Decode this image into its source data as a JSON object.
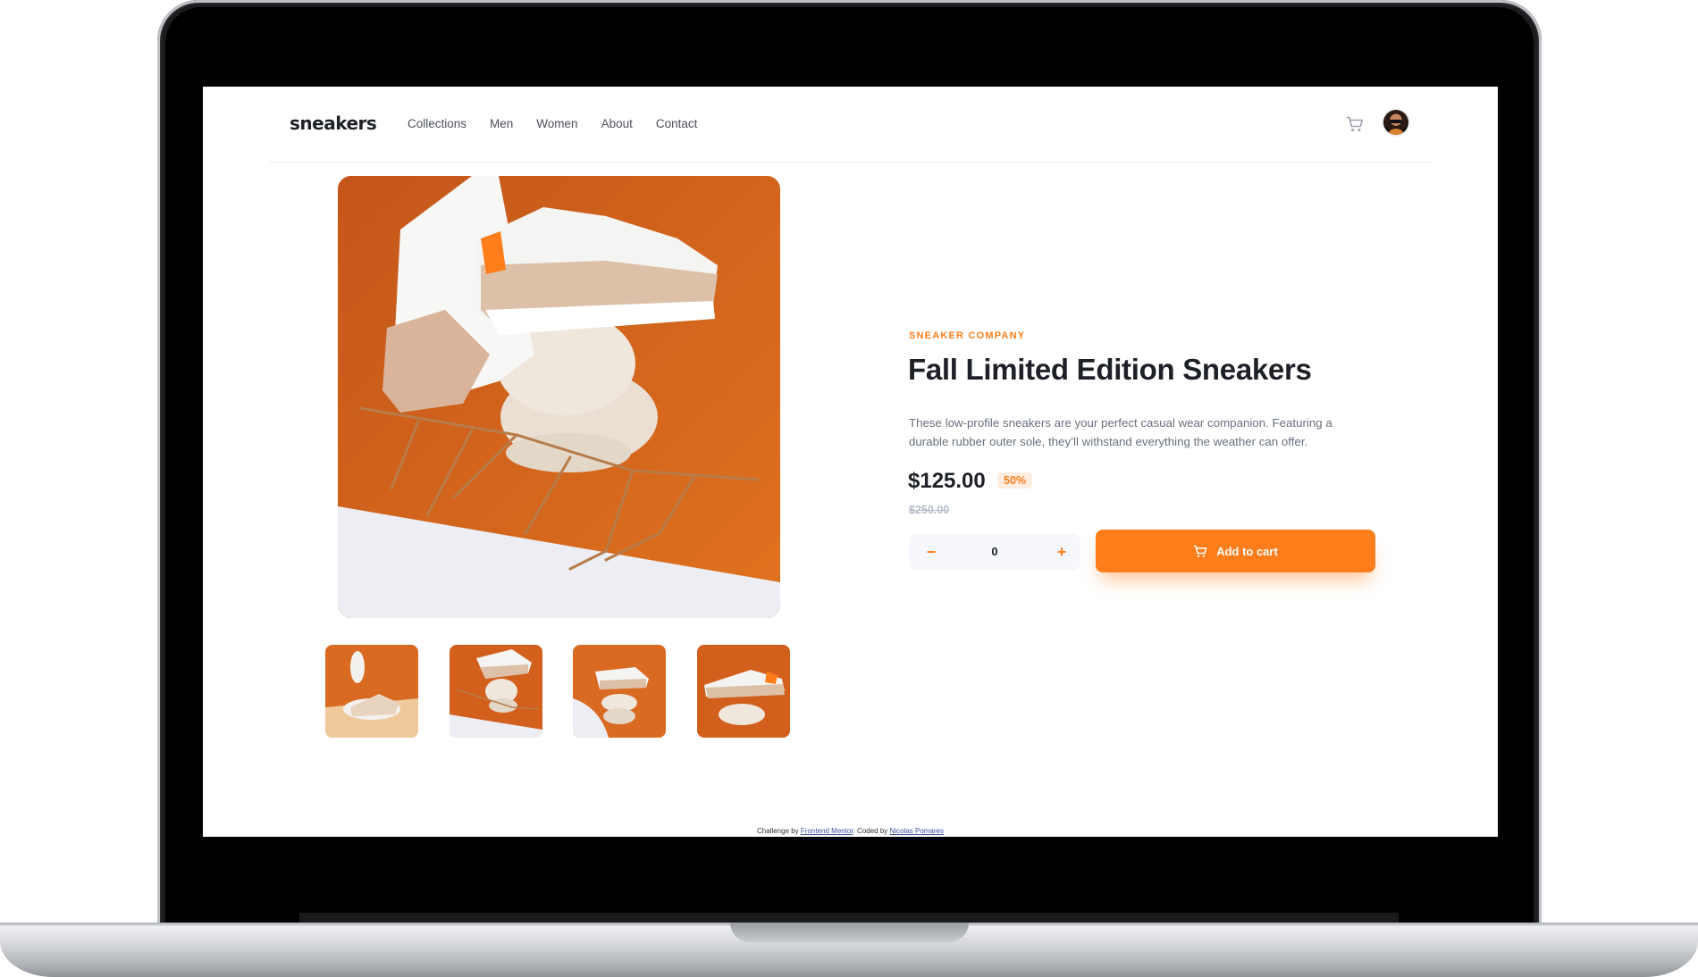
{
  "nav": {
    "logo": "sneakers",
    "links": [
      "Collections",
      "Men",
      "Women",
      "About",
      "Contact"
    ],
    "cart_icon": "cart-icon",
    "avatar": "user-avatar"
  },
  "product": {
    "company": "SNEAKER COMPANY",
    "title": "Fall Limited Edition Sneakers",
    "description": "These low-profile sneakers are your perfect casual wear companion. Featuring a durable rubber outer sole, they’ll withstand everything the weather can offer.",
    "price": "$125.00",
    "discount": "50%",
    "original_price": "$250.00",
    "quantity": "0",
    "minus": "−",
    "plus": "+",
    "add_to_cart": "Add to cart"
  },
  "gallery": {
    "thumbnails": 4,
    "accent": "#ff7e1b"
  },
  "footer": {
    "prefix": "Challenge by ",
    "link1": "Frontend Mentor",
    "middle": ". Coded by ",
    "link2": "Nicolas Pomares"
  },
  "colors": {
    "primary": "#ff7e1b",
    "primary_light": "#ffede0",
    "text_dark": "#1d2026",
    "text_grey": "#68707d"
  }
}
